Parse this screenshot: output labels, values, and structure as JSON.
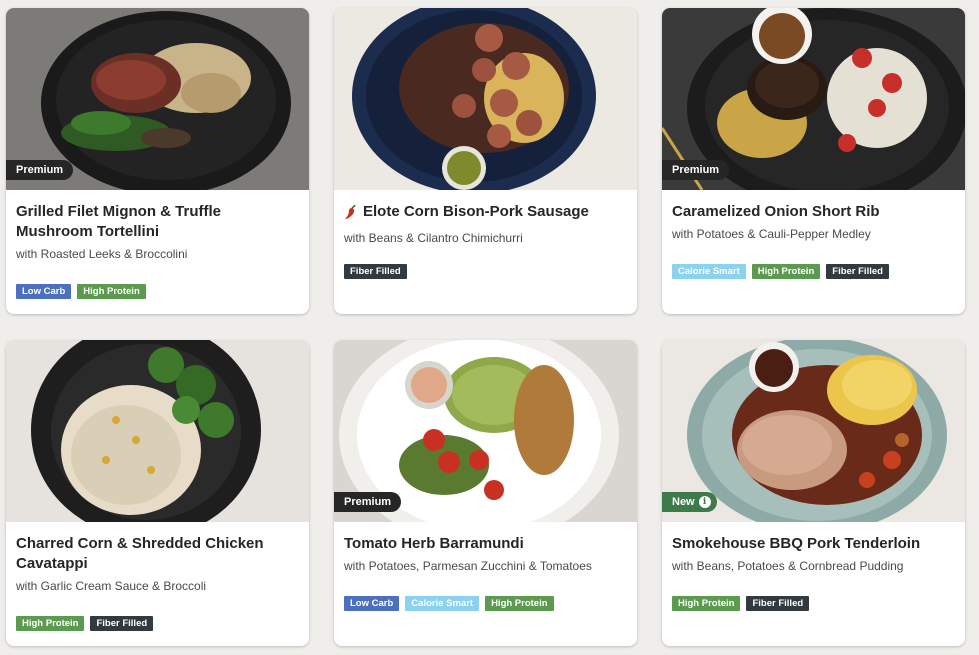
{
  "colors": {
    "low_carb": "#4d6fc0",
    "high_protein": "#5c9a4f",
    "fiber_filled": "#333a3f",
    "calorie_smart": "#8ad2ef",
    "premium": "#262626",
    "new": "#3f7a4a"
  },
  "meals": [
    {
      "title": "Grilled Filet Mignon & Truffle Mushroom Tortellini",
      "subtitle": "with Roasted Leeks & Broccolini",
      "tag": "Premium",
      "badges": [
        "Low Carb",
        "High Protein"
      ]
    },
    {
      "title": "Elote Corn Bison-Pork Sausage",
      "subtitle": "with Beans & Cilantro Chimichurri",
      "spicy_icon": "chili-pepper-icon",
      "badges": [
        "Fiber Filled"
      ]
    },
    {
      "title": "Caramelized Onion Short Rib",
      "subtitle": "with Potatoes & Cauli-Pepper Medley",
      "tag": "Premium",
      "badges": [
        "Calorie Smart",
        "High Protein",
        "Fiber Filled"
      ]
    },
    {
      "title": "Charred Corn & Shredded Chicken Cavatappi",
      "subtitle": "with Garlic Cream Sauce & Broccoli",
      "badges": [
        "High Protein",
        "Fiber Filled"
      ]
    },
    {
      "title": "Tomato Herb Barramundi",
      "subtitle": "with Potatoes, Parmesan Zucchini & Tomatoes",
      "tag": "Premium",
      "badges": [
        "Low Carb",
        "Calorie Smart",
        "High Protein"
      ]
    },
    {
      "title": "Smokehouse BBQ Pork Tenderloin",
      "subtitle": "with Beans, Potatoes & Cornbread Pudding",
      "tag": "New",
      "tag_icon": "info-icon",
      "badges": [
        "High Protein",
        "Fiber Filled"
      ]
    }
  ]
}
